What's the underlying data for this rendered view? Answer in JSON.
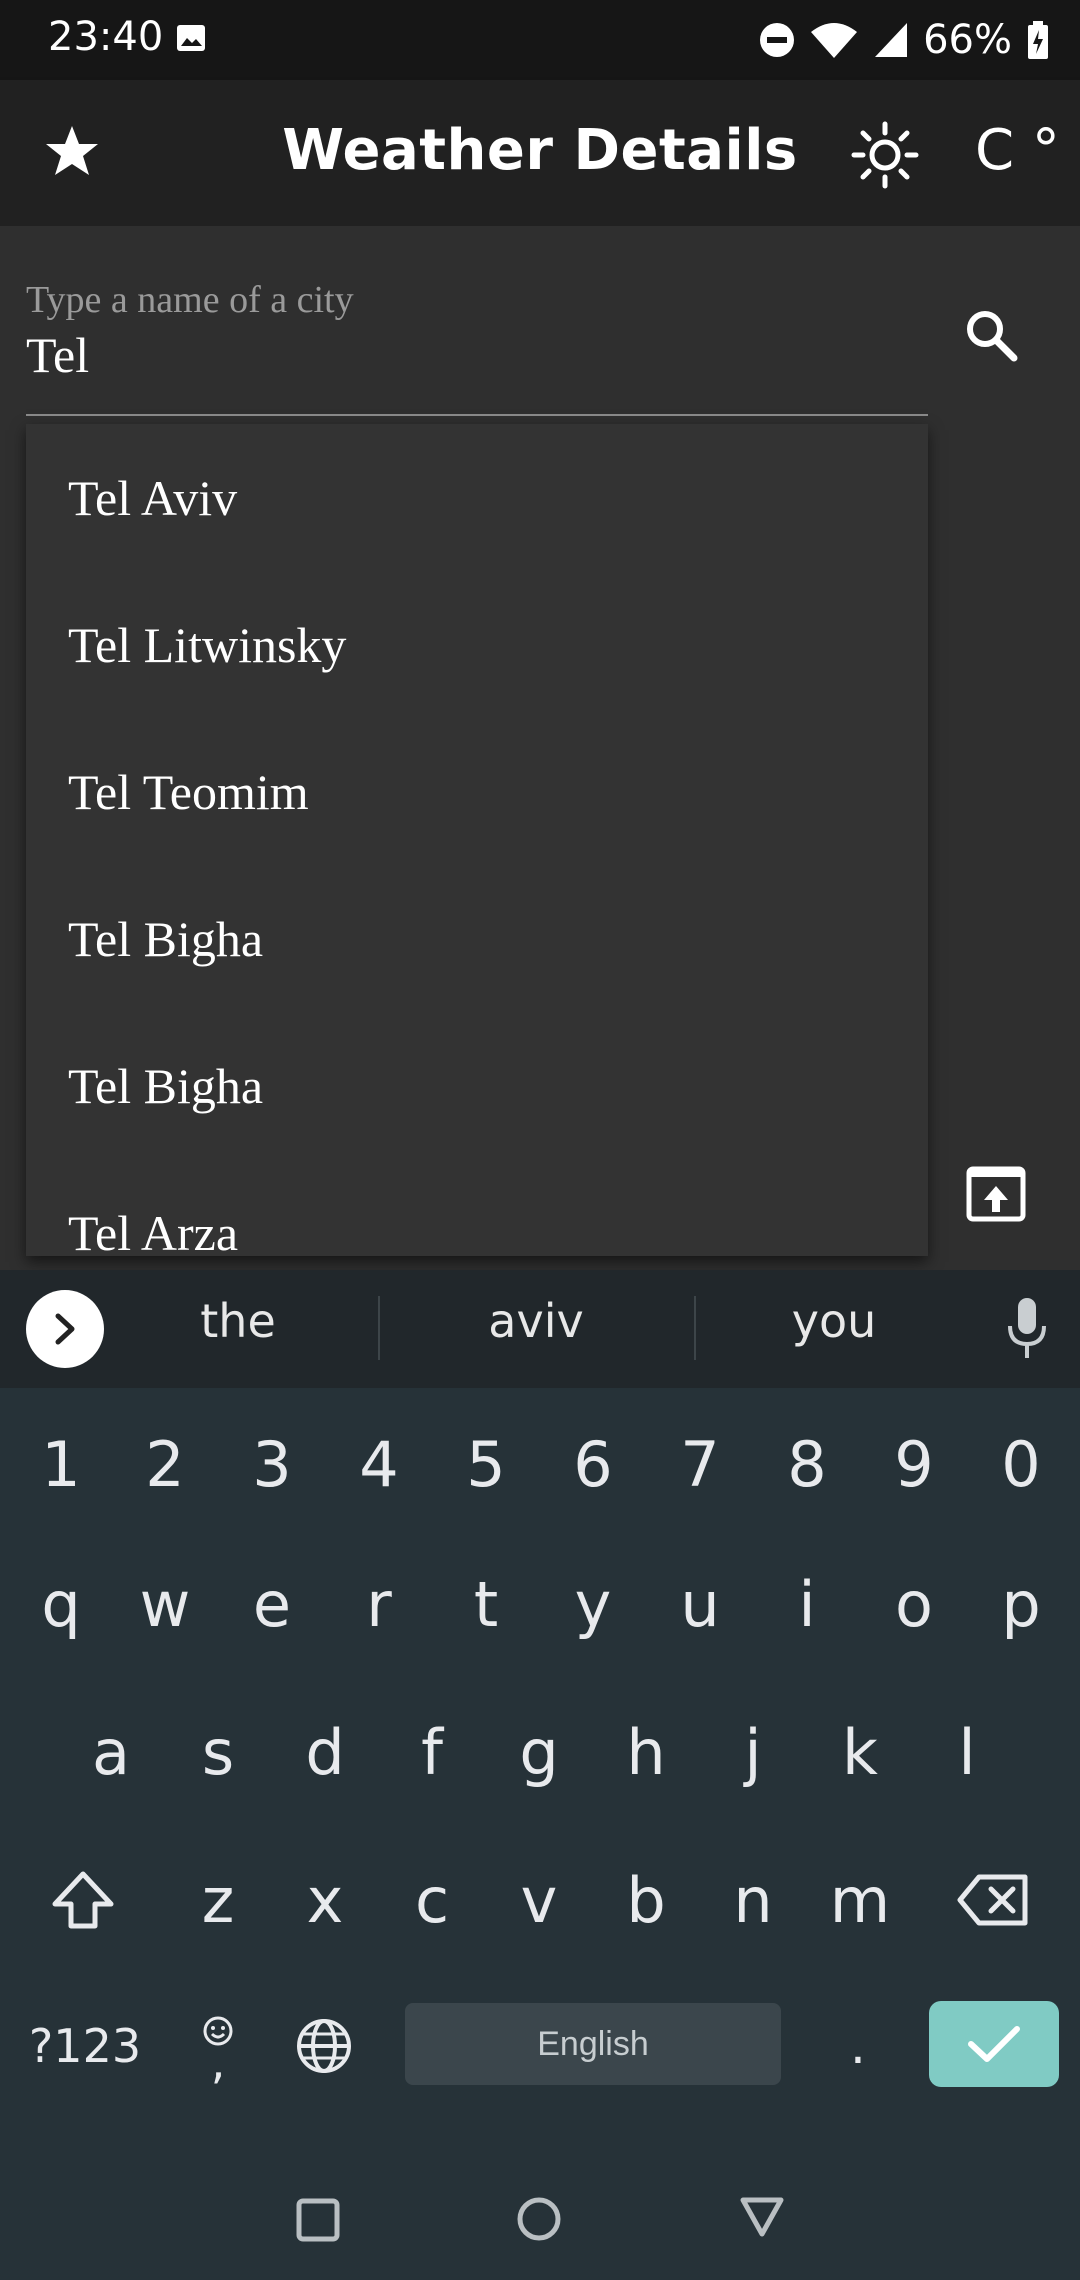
{
  "status_bar": {
    "time": "23:40",
    "battery": "66%",
    "icons": [
      "image-icon",
      "dnd-icon",
      "wifi-icon",
      "signal-icon",
      "battery-icon"
    ]
  },
  "app_bar": {
    "title": "Weather Details",
    "unit_label": "C °",
    "icons": [
      "star-icon",
      "brightness-icon"
    ]
  },
  "search": {
    "placeholder": "Type a name of a city",
    "value": "Tel",
    "icon": "search-icon"
  },
  "suggestions": [
    "Tel Aviv",
    "Tel Litwinsky",
    "Tel Teomim",
    "Tel Bigha",
    "Tel Bigha",
    "Tel Arza"
  ],
  "keyboard": {
    "suggestions": [
      "the",
      "aviv",
      "you"
    ],
    "number_row": [
      "1",
      "2",
      "3",
      "4",
      "5",
      "6",
      "7",
      "8",
      "9",
      "0"
    ],
    "row1": [
      "q",
      "w",
      "e",
      "r",
      "t",
      "y",
      "u",
      "i",
      "o",
      "p"
    ],
    "row2": [
      "a",
      "s",
      "d",
      "f",
      "g",
      "h",
      "j",
      "k",
      "l"
    ],
    "row3": [
      "z",
      "x",
      "c",
      "v",
      "b",
      "n",
      "m"
    ],
    "symbols_label": "?123",
    "emoji_comma": ",",
    "space_label": "English",
    "period": ".",
    "accent_color": "#80cbc4"
  },
  "colors": {
    "app_bar": "#212121",
    "background": "#2f2f2f",
    "keyboard": "#263238"
  }
}
